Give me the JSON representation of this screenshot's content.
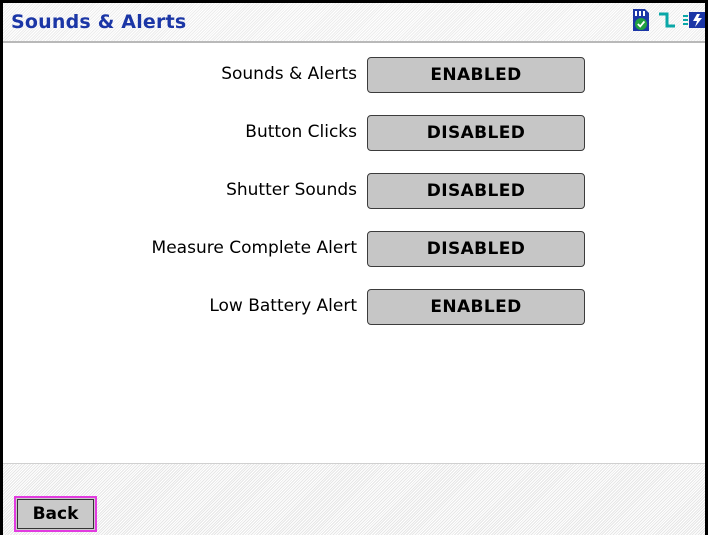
{
  "window": {
    "title": "Sounds & Alerts"
  },
  "status_bar": {
    "icons": [
      "sd-card-check-icon",
      "signal-pulse-icon",
      "battery-charging-icon"
    ],
    "colors": {
      "sd_card_fill": "#20a040",
      "sd_card_outline": "#1b36a6",
      "accent_blue": "#1b36a6",
      "signal_cyan": "#0aa7a7"
    }
  },
  "settings": [
    {
      "label": "Sounds & Alerts",
      "value": "ENABLED"
    },
    {
      "label": "Button Clicks",
      "value": "DISABLED"
    },
    {
      "label": "Shutter Sounds",
      "value": "DISABLED"
    },
    {
      "label": "Measure Complete Alert",
      "value": "DISABLED"
    },
    {
      "label": "Low Battery Alert",
      "value": "ENABLED"
    }
  ],
  "footer": {
    "back_label": "Back"
  }
}
